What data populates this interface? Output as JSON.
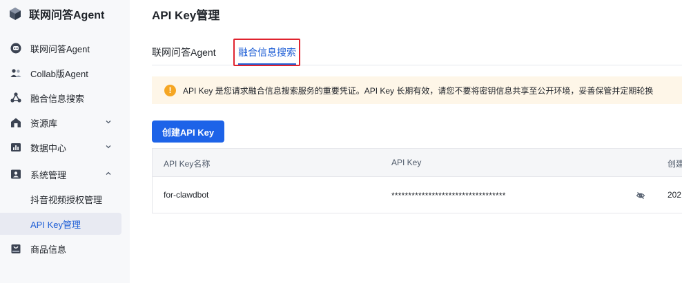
{
  "brand": {
    "name": "联网问答Agent"
  },
  "sidebar": {
    "items": [
      {
        "label": "联网问答Agent",
        "icon": "chat-bot-icon"
      },
      {
        "label": "Collab版Agent",
        "icon": "users-icon"
      },
      {
        "label": "融合信息搜索",
        "icon": "nodes-icon"
      },
      {
        "label": "资源库",
        "icon": "home-icon"
      },
      {
        "label": "数据中心",
        "icon": "chart-icon"
      },
      {
        "label": "系统管理",
        "icon": "id-card-icon"
      },
      {
        "label": "抖音视频授权管理"
      },
      {
        "label": "API Key管理"
      },
      {
        "label": "商品信息",
        "icon": "bag-icon"
      }
    ]
  },
  "main": {
    "title": "API Key管理",
    "tabs": [
      {
        "label": "联网问答Agent"
      },
      {
        "label": "融合信息搜索"
      }
    ],
    "notice": "API Key 是您请求融合信息搜索服务的重要凭证。API Key 长期有效，请您不要将密钥信息共享至公开环境，妥善保管并定期轮换",
    "create_button": "创建API Key",
    "table": {
      "columns": [
        "API Key名称",
        "API Key",
        "创建"
      ],
      "rows": [
        {
          "name": "for-clawdbot",
          "key": "**********************************",
          "created": "202"
        }
      ]
    }
  },
  "colors": {
    "accent": "#1d63e8",
    "active_text": "#1f5fd6",
    "highlight_box": "#e0232e",
    "notice_bg": "#fef6e8",
    "warning": "#f5a623"
  }
}
